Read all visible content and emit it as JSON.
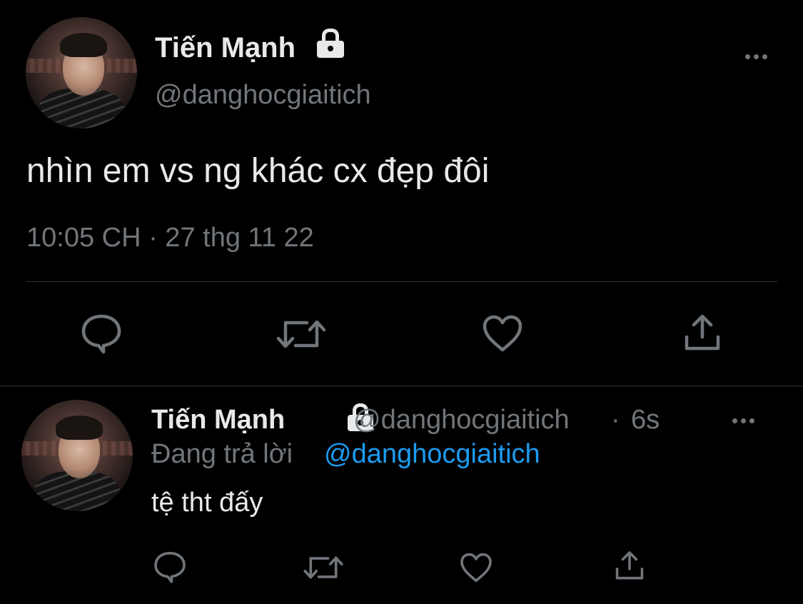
{
  "main_tweet": {
    "display_name": "Tiến Mạnh",
    "handle": "@danghocgiaitich",
    "text": "nhìn em vs ng khác cx đẹp đôi",
    "timestamp": "10:05 CH · 27 thg 11 22",
    "icons": [
      "lock-icon",
      "more-icon",
      "reply-icon",
      "retweet-icon",
      "like-icon",
      "share-icon"
    ]
  },
  "reply_tweet": {
    "display_name": "Tiến Mạnh",
    "handle": "@danghocgiaitich",
    "separator": "·",
    "time_ago": "6s",
    "replying_prefix": "Đang trả lời",
    "replying_to": "@danghocgiaitich",
    "text": "tệ tht đấy"
  },
  "colors": {
    "background": "#000000",
    "text": "#e7e9ea",
    "muted": "#71767b",
    "link": "#1d9bf0",
    "divider": "#2f3336"
  }
}
